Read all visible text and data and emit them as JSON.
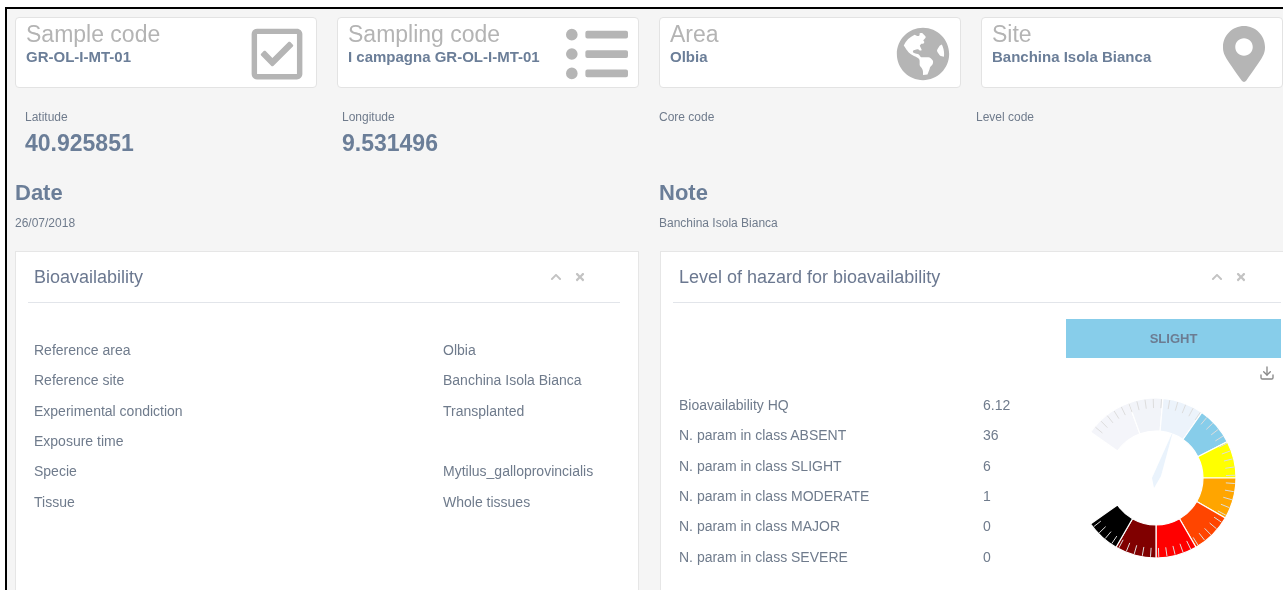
{
  "summary_cards": [
    {
      "title": "Sample code",
      "value": "GR-OL-I-MT-01"
    },
    {
      "title": "Sampling code",
      "value": "I campagna GR-OL-I-MT-01"
    },
    {
      "title": "Area",
      "value": "Olbia"
    },
    {
      "title": "Site",
      "value": "Banchina Isola Bianca"
    }
  ],
  "coordinates": [
    {
      "label": "Latitude",
      "value": "40.925851"
    },
    {
      "label": "Longitude",
      "value": "9.531496"
    },
    {
      "label": "Core code"
    },
    {
      "label": "Level code"
    }
  ],
  "notes": [
    {
      "title": "Date",
      "value": "26/07/2018"
    },
    {
      "title": "Note",
      "value": "Banchina Isola Bianca"
    }
  ],
  "bioavailability_panel": {
    "title": "Bioavailability",
    "rows": [
      {
        "label": "Reference area",
        "value": "Olbia"
      },
      {
        "label": "Reference site",
        "value": "Banchina Isola Bianca"
      },
      {
        "label": "Experimental condiction",
        "value": "Transplanted"
      },
      {
        "label": "Exposure time"
      },
      {
        "label": "Specie",
        "value": "Mytilus_galloprovincialis"
      },
      {
        "label": "Tissue",
        "value": "Whole tissues"
      }
    ]
  },
  "hazard_panel": {
    "title": "Level of hazard for bioavailability",
    "level_badge": "SLIGHT",
    "rows": [
      {
        "label": "Bioavailability HQ",
        "value": "6.12"
      },
      {
        "label": "N. param in class ABSENT",
        "value": "36"
      },
      {
        "label": "N. param in class SLIGHT",
        "value": "6"
      },
      {
        "label": "N. param in class MODERATE",
        "value": "1"
      },
      {
        "label": "N. param in class MAJOR",
        "value": "0"
      },
      {
        "label": "N. param in class SEVERE",
        "value": "0"
      }
    ]
  }
}
